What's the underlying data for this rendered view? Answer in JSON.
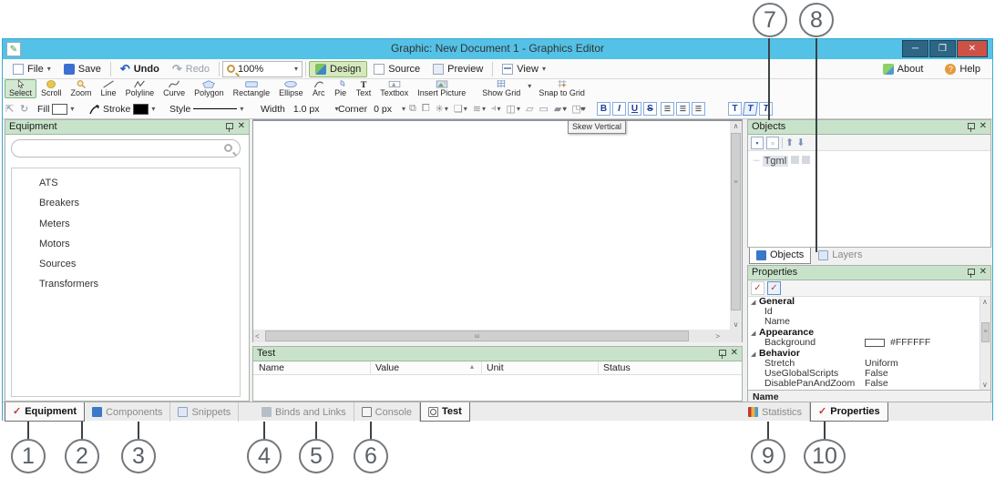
{
  "callouts": {
    "c1": "1",
    "c2": "2",
    "c3": "3",
    "c4": "4",
    "c5": "5",
    "c6": "6",
    "c7": "7",
    "c8": "8",
    "c9": "9",
    "c10": "10"
  },
  "titlebar": {
    "title": "Graphic: New Document 1 - Graphics Editor",
    "minimize": "─",
    "maximize": "❐",
    "close": "✕"
  },
  "menubar": {
    "file": "File",
    "save": "Save",
    "undo": "Undo",
    "redo": "Redo",
    "zoom": "100%",
    "design": "Design",
    "source": "Source",
    "preview": "Preview",
    "view": "View",
    "about": "About",
    "help": "Help"
  },
  "tools": {
    "t0": "Select",
    "t1": "Scroll",
    "t2": "Zoom",
    "t3": "Line",
    "t4": "Polyline",
    "t5": "Curve",
    "t6": "Polygon",
    "t7": "Rectangle",
    "t8": "Ellipse",
    "t9": "Arc",
    "t10": "Pie",
    "t11": "Text",
    "t12": "Textbox",
    "t13": "Insert Picture",
    "t14": "Show Grid",
    "t15": "Snap to Grid"
  },
  "format": {
    "fill": "Fill",
    "stroke": "Stroke",
    "style": "Style",
    "width": "Width",
    "width_value": "1.0 px",
    "corner": "Corner",
    "corner_value": "0 px",
    "bold": "B",
    "italic": "I",
    "underline": "U",
    "strike": "S",
    "skew1": "T",
    "skew2": "T",
    "skew3": "T",
    "tooltip": "Skew Vertical"
  },
  "equipment": {
    "title": "Equipment",
    "search_value": "",
    "items": {
      "i0": "ATS",
      "i1": "Breakers",
      "i2": "Meters",
      "i3": "Motors",
      "i4": "Sources",
      "i5": "Transformers"
    },
    "tabs": {
      "equipment": "Equipment",
      "components": "Components",
      "snippets": "Snippets"
    }
  },
  "test": {
    "title": "Test",
    "columns": {
      "name": "Name",
      "value": "Value",
      "unit": "Unit",
      "status": "Status"
    },
    "sort_indicator": "▴",
    "tabs": {
      "binds": "Binds and Links",
      "console": "Console",
      "test": "Test"
    }
  },
  "objects": {
    "title": "Objects",
    "tree_root": "Tgml",
    "tabs": {
      "objects": "Objects",
      "layers": "Layers"
    }
  },
  "properties": {
    "title": "Properties",
    "rows": {
      "r0": {
        "k": "General"
      },
      "r1": {
        "k": "Id",
        "v": ""
      },
      "r2": {
        "k": "Name",
        "v": ""
      },
      "r3": {
        "k": "Appearance"
      },
      "r4": {
        "k": "Background",
        "v": "#FFFFFF"
      },
      "r5": {
        "k": "Behavior"
      },
      "r6": {
        "k": "Stretch",
        "v": "Uniform"
      },
      "r7": {
        "k": "UseGlobalScripts",
        "v": "False"
      },
      "r8": {
        "k": "DisablePanAndZoom",
        "v": "False"
      }
    },
    "description": "Name",
    "tabs": {
      "statistics": "Statistics",
      "properties": "Properties"
    }
  },
  "colors": {
    "titlebar": "#54c2e6",
    "panel_header": "#c9e3ca",
    "design_active": "#d6e9bd",
    "select_active": "#d3e8d1",
    "close_button": "#cc5246",
    "canvas_background": "#FFFFFF"
  }
}
